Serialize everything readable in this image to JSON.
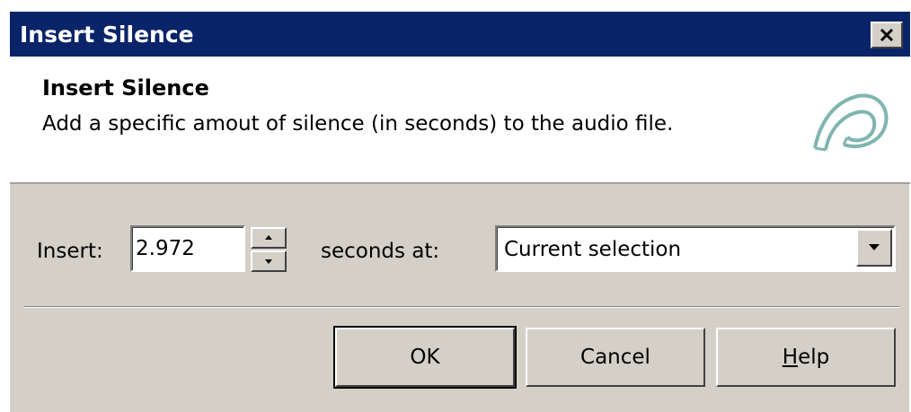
{
  "window": {
    "title": "Insert Silence"
  },
  "header": {
    "title": "Insert Silence",
    "description": "Add a specific amout of silence (in seconds) to the audio file.",
    "logo_icon": "sound-forge-logo-icon"
  },
  "form": {
    "insert_label": "Insert:",
    "insert_value": "2.972",
    "seconds_label": "seconds at:",
    "position_selected": "Current selection"
  },
  "buttons": {
    "ok_label": "OK",
    "cancel_label": "Cancel",
    "help_mnemonic": "H",
    "help_rest": "elp"
  },
  "colors": {
    "titlebar": "#0a246a",
    "face": "#d4d0c8",
    "logo": "#7fb5b0"
  }
}
